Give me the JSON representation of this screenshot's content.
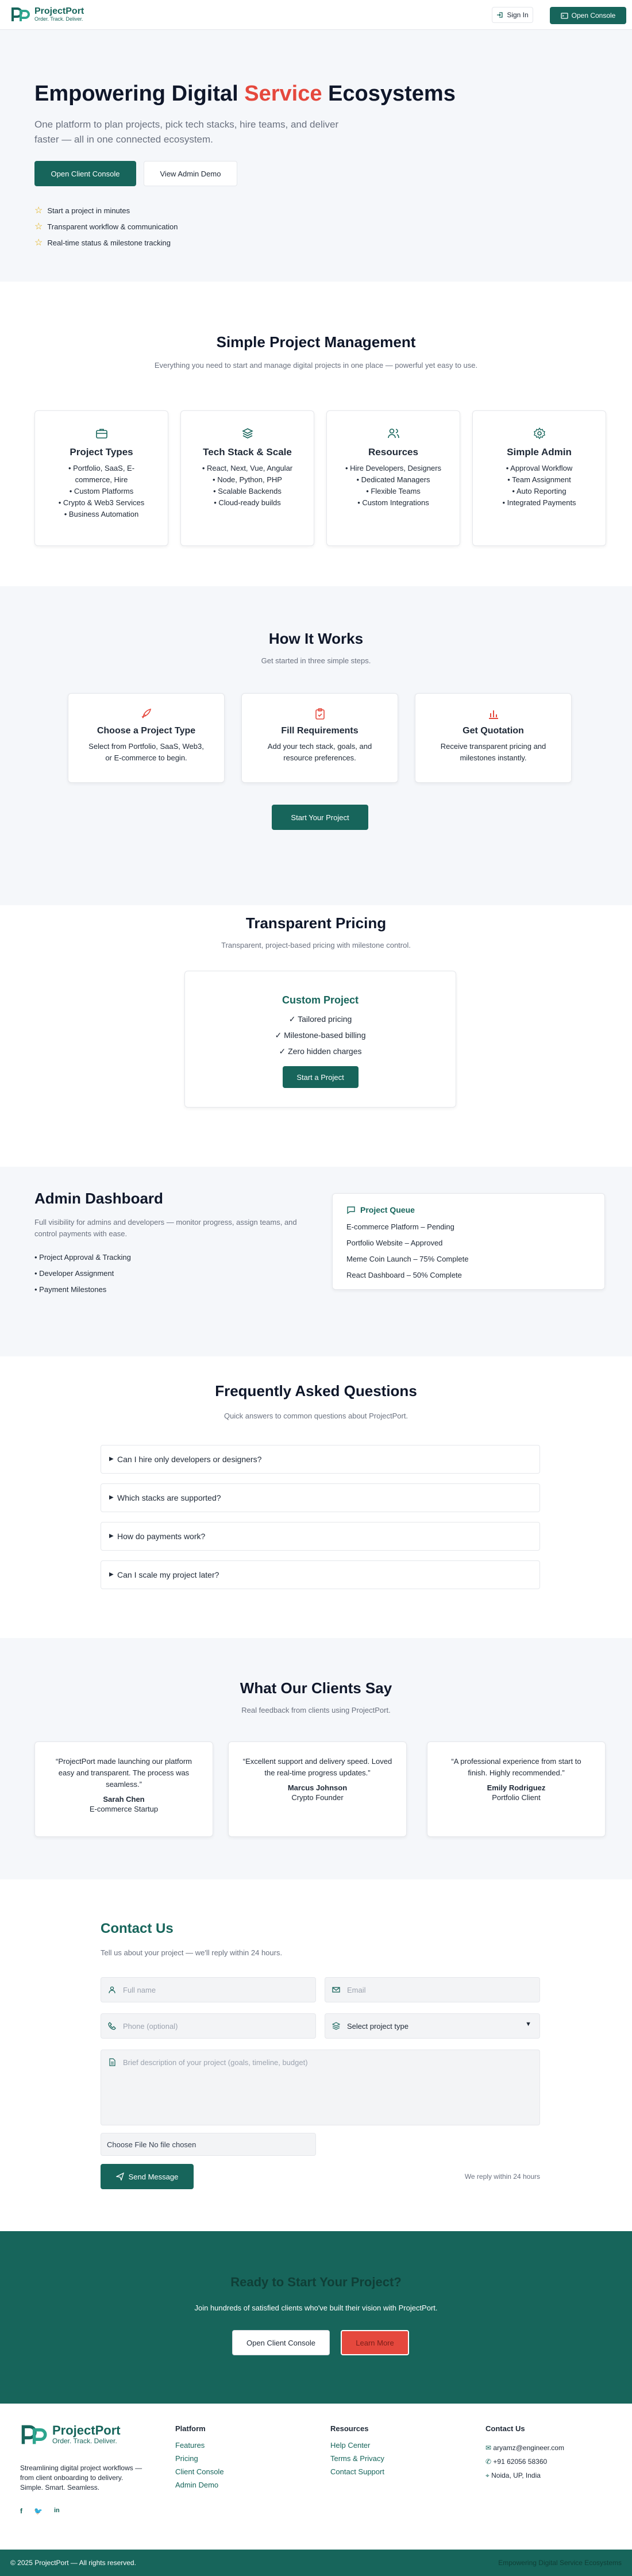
{
  "brand": {
    "name": "ProjectPort",
    "tagline": "Order. Track. Deliver."
  },
  "nav": {
    "signin": "Sign In",
    "open_console": "Open Console"
  },
  "hero": {
    "title_a": "Empowering Digital ",
    "title_hl": "Service",
    "title_b": " Ecosystems",
    "subtitle": "One platform to plan projects, pick tech stacks, hire teams, and deliver faster — all in one connected ecosystem.",
    "primary": "Open Client Console",
    "secondary": "View Admin Demo",
    "points": [
      "Start a project in minutes",
      "Transparent workflow & communication",
      "Real-time status & milestone tracking"
    ]
  },
  "spm": {
    "title": "Simple Project Management",
    "subtitle": "Everything you need to start and manage digital projects in one place — powerful yet easy to use.",
    "cards": [
      {
        "title": "Project Types",
        "items": [
          "• Portfolio, SaaS, E-commerce, Hire",
          "• Custom Platforms",
          "• Crypto & Web3 Services",
          "• Business Automation"
        ]
      },
      {
        "title": "Tech Stack & Scale",
        "items": [
          "• React, Next, Vue, Angular",
          "• Node, Python, PHP",
          "• Scalable Backends",
          "• Cloud-ready builds"
        ]
      },
      {
        "title": "Resources",
        "items": [
          "• Hire Developers, Designers",
          "• Dedicated Managers",
          "• Flexible Teams",
          "• Custom Integrations"
        ]
      },
      {
        "title": "Simple Admin",
        "items": [
          "• Approval Workflow",
          "• Team Assignment",
          "• Auto Reporting",
          "• Integrated Payments"
        ]
      }
    ]
  },
  "how": {
    "title": "How It Works",
    "subtitle": "Get started in three simple steps.",
    "steps": [
      {
        "title": "Choose a Project Type",
        "text": "Select from Portfolio, SaaS, Web3, or E-commerce to begin."
      },
      {
        "title": "Fill Requirements",
        "text": "Add your tech stack, goals, and resource preferences."
      },
      {
        "title": "Get Quotation",
        "text": "Receive transparent pricing and milestones instantly."
      }
    ],
    "cta": "Start Your Project"
  },
  "pricing": {
    "title": "Transparent Pricing",
    "subtitle": "Transparent, project-based pricing with milestone control.",
    "plan": "Custom Project",
    "features": [
      "✓ Tailored pricing",
      "✓ Milestone-based billing",
      "✓ Zero hidden charges"
    ],
    "cta": "Start a Project"
  },
  "admin": {
    "title": "Admin Dashboard",
    "subtitle": "Full visibility for admins and developers — monitor progress, assign teams, and control payments with ease.",
    "points": [
      "• Project Approval & Tracking",
      "• Developer Assignment",
      "• Payment Milestones"
    ],
    "queue_title": "Project Queue",
    "queue": [
      "E-commerce Platform – Pending",
      "Portfolio Website – Approved",
      "Meme Coin Launch – 75% Complete",
      "React Dashboard – 50% Complete"
    ]
  },
  "faq": {
    "title": "Frequently Asked Questions",
    "subtitle": "Quick answers to common questions about ProjectPort.",
    "items": [
      "Can I hire only developers or designers?",
      "Which stacks are supported?",
      "How do payments work?",
      "Can I scale my project later?"
    ]
  },
  "testimonials": {
    "title": "What Our Clients Say",
    "subtitle": "Real feedback from clients using ProjectPort.",
    "items": [
      {
        "quote": "“ProjectPort made launching our platform easy and transparent. The process was seamless.”",
        "name": "Sarah Chen",
        "role": "E-commerce Startup"
      },
      {
        "quote": "“Excellent support and delivery speed. Loved the real-time progress updates.”",
        "name": "Marcus Johnson",
        "role": "Crypto Founder"
      },
      {
        "quote": "“A professional experience from start to finish. Highly recommended.”",
        "name": "Emily Rodriguez",
        "role": "Portfolio Client"
      }
    ]
  },
  "contact": {
    "title": "Contact Us",
    "subtitle": "Tell us about your project — we'll reply within 24 hours.",
    "full_name": "Full name",
    "email": "Email",
    "phone": "Phone (optional)",
    "project_type": "Select project type",
    "description": "Brief description of your project (goals, timeline, budget)",
    "file_btn": "Choose File",
    "file_status": "No file chosen",
    "send": "Send Message",
    "reply_note": "We reply within 24 hours"
  },
  "cta": {
    "title": "Ready to Start Your Project?",
    "subtitle": "Join hundreds of satisfied clients who've built their vision with ProjectPort.",
    "primary": "Open Client Console",
    "secondary": "Learn More"
  },
  "footer": {
    "desc": "Streamlining digital project workflows — from client onboarding to delivery. Simple. Smart. Seamless.",
    "platform_title": "Platform",
    "platform": [
      "Features",
      "Pricing",
      "Client Console",
      "Admin Demo"
    ],
    "resources_title": "Resources",
    "resources": [
      "Help Center",
      "Terms & Privacy",
      "Contact Support"
    ],
    "contact_title": "Contact Us",
    "email": "aryamz@engineer.com",
    "phone": "+91 62056 58360",
    "location": "Noida, UP, India",
    "copyright": "© 2025 ProjectPort — All rights reserved.",
    "right_text": "Empowering Digital Service Ecosystems"
  },
  "colors": {
    "accent": "#17655b",
    "highlight": "#e5483d",
    "soft_bg": "#f5f7fa"
  }
}
